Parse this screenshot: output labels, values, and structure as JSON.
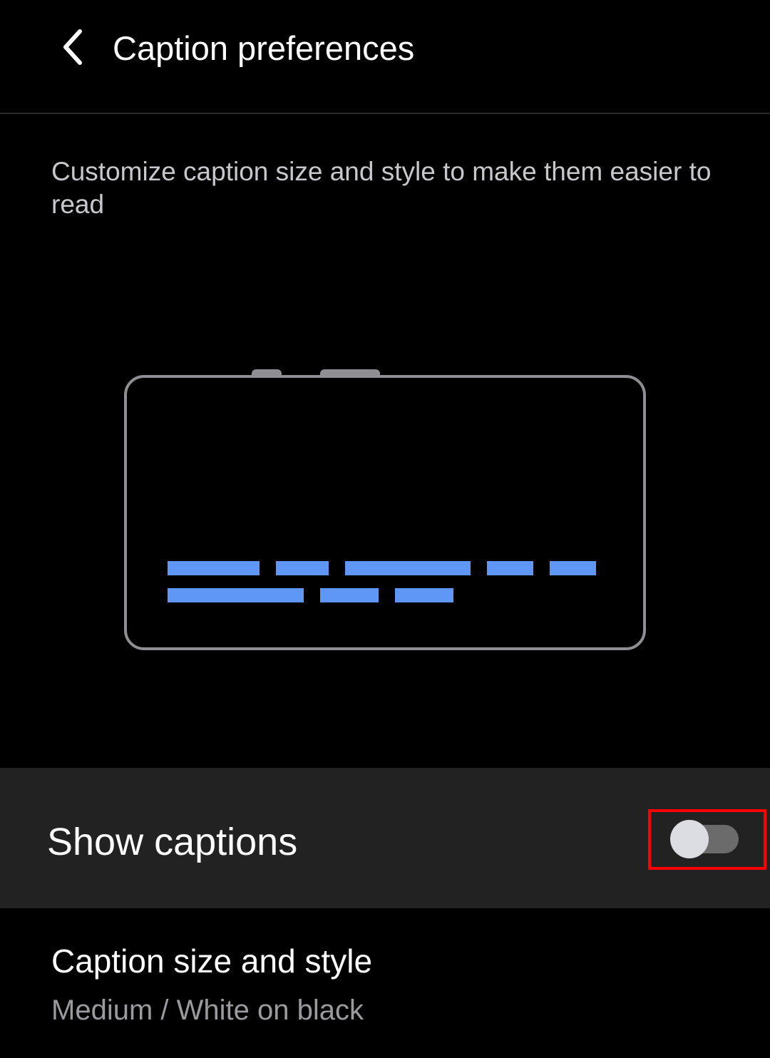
{
  "header": {
    "back_icon": "chevron-left-icon",
    "title": "Caption preferences"
  },
  "description": "Customize caption size and style to make them easier to read",
  "preview": {
    "illustration": "phone-landscape-with-captions",
    "frame_color": "#8e8e93",
    "caption_color": "#5e97f6"
  },
  "show_captions": {
    "label": "Show captions",
    "enabled": false
  },
  "caption_style": {
    "title": "Caption size and style",
    "summary": "Medium / White on black"
  },
  "colors": {
    "background": "#000000",
    "highlighted_row": "#222222",
    "highlight_box": "#ff0000"
  }
}
